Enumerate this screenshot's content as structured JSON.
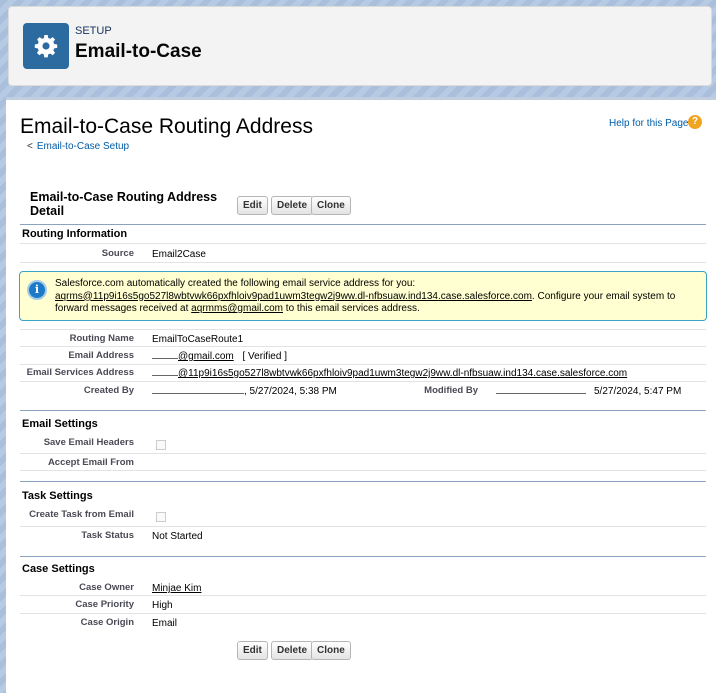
{
  "header": {
    "setup_label": "SETUP",
    "title": "Email-to-Case",
    "icon": "gear-icon",
    "icon_color": "#2c6ba0"
  },
  "page": {
    "title": "Email-to-Case Routing Address",
    "back_link": "Email-to-Case Setup",
    "back_prefix": "<",
    "help_link": "Help for this Page",
    "help_icon": "?"
  },
  "detail": {
    "title": "Email-to-Case Routing Address Detail",
    "buttons": {
      "edit": "Edit",
      "delete": "Delete",
      "clone": "Clone"
    }
  },
  "routing": {
    "section_title": "Routing Information",
    "source_label": "Source",
    "source_value": "Email2Case",
    "info_line1": "Salesforce.com automatically created the following email service address for you:",
    "info_address": "aqrms@11p9i16s5go527l8wbtvwk66pxfhloiv9pad1uwm3tegw2j9ww.dl-nfbsuaw.ind134.case.salesforce.com",
    "info_mid": ". Configure your email system to forward messages received at ",
    "info_email": "aqrmms@gmail.com",
    "info_end": " to this email services address.",
    "routing_name_label": "Routing Name",
    "routing_name_value": "EmailToCaseRoute1",
    "email_address_label": "Email Address",
    "email_address_value": "@gmail.com",
    "email_verified": "[ Verified ]",
    "services_label": "Email Services Address",
    "services_value": "@11p9i16s5go527l8wbtvwk66pxfhloiv9pad1uwm3tegw2j9ww.dl-nfbsuaw.ind134.case.salesforce.com",
    "created_by_label": "Created By",
    "created_by_value": ", 5/27/2024, 5:38 PM",
    "modified_by_label": "Modified By",
    "modified_by_value": "5/27/2024, 5:47 PM"
  },
  "email_settings": {
    "section_title": "Email Settings",
    "save_headers_label": "Save Email Headers",
    "accept_from_label": "Accept Email From"
  },
  "task_settings": {
    "section_title": "Task Settings",
    "create_task_label": "Create Task from Email",
    "task_status_label": "Task Status",
    "task_status_value": "Not Started"
  },
  "case_settings": {
    "section_title": "Case Settings",
    "owner_label": "Case Owner",
    "owner_value": "Minjae Kim",
    "priority_label": "Case Priority",
    "priority_value": "High",
    "origin_label": "Case Origin",
    "origin_value": "Email"
  }
}
